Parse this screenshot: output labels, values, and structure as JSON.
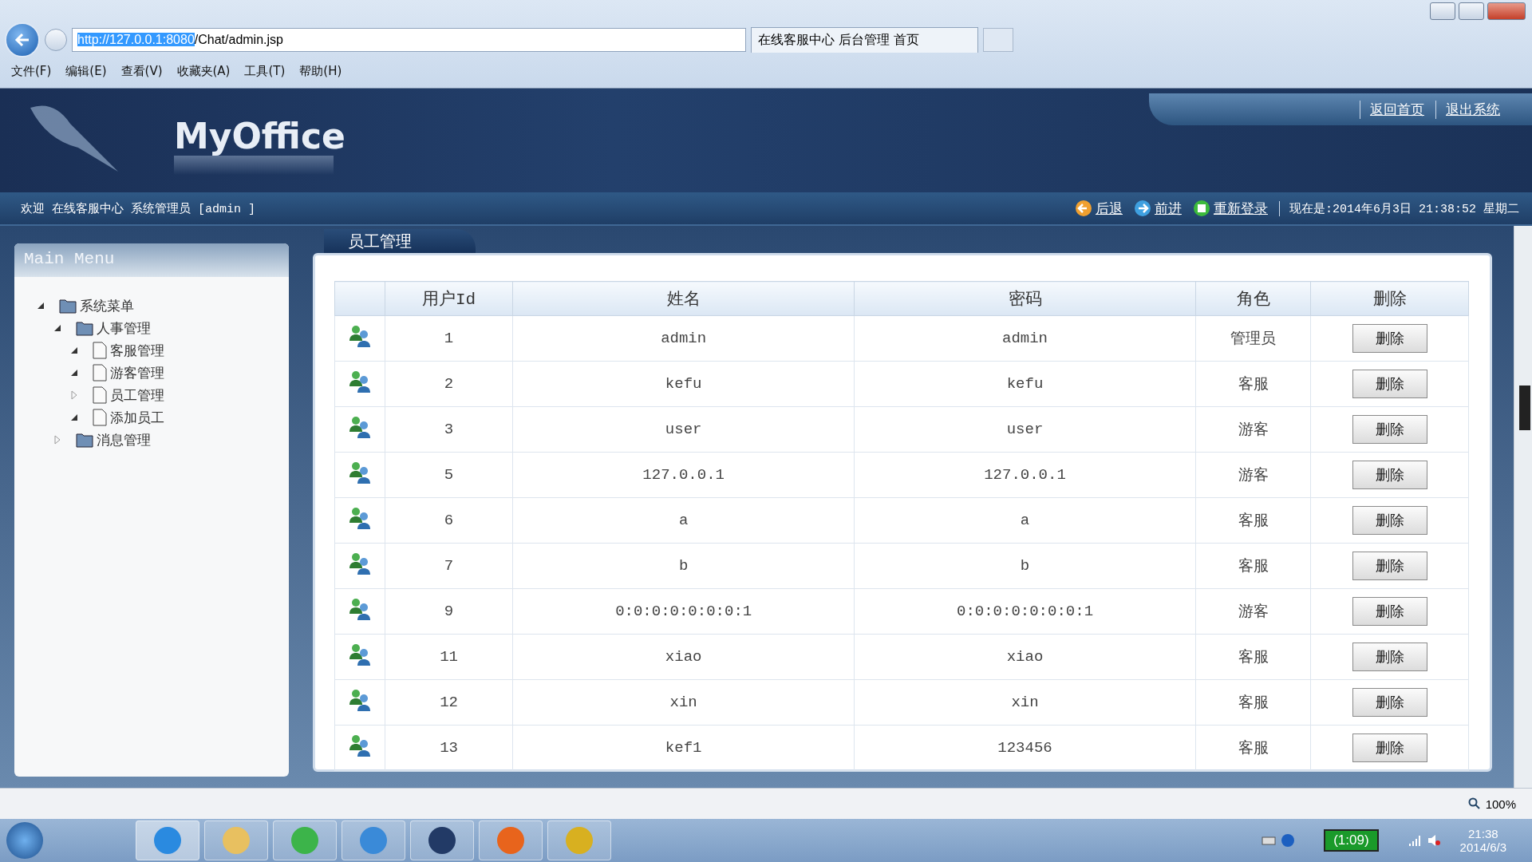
{
  "browser": {
    "address_selected": "http://127.0.0.1:8080",
    "address_rest": "/Chat/admin.jsp",
    "tab_title": "在线客服中心 后台管理 首页",
    "menu": [
      "文件(F)",
      "编辑(E)",
      "查看(V)",
      "收藏夹(A)",
      "工具(T)",
      "帮助(H)"
    ],
    "zoom": "100%"
  },
  "header": {
    "logo": "MyOffice",
    "links": [
      "返回首页",
      "退出系统"
    ]
  },
  "strip": {
    "welcome": "欢迎 在线客服中心 系统管理员 [admin ]",
    "nav": [
      {
        "label": "后退",
        "kind": "back"
      },
      {
        "label": "前进",
        "kind": "forward"
      },
      {
        "label": "重新登录",
        "kind": "relogin"
      }
    ],
    "clock": "现在是:2014年6月3日 21:38:52 星期二"
  },
  "sidebar": {
    "title": "Main Menu",
    "tree": [
      {
        "label": "系统菜单",
        "kind": "folder",
        "expanded": true,
        "children": [
          {
            "label": "人事管理",
            "kind": "folder",
            "expanded": true,
            "children": [
              {
                "label": "客服管理",
                "kind": "page",
                "expanded": true
              },
              {
                "label": "游客管理",
                "kind": "page",
                "expanded": true
              },
              {
                "label": "员工管理",
                "kind": "page",
                "expanded": false
              },
              {
                "label": "添加员工",
                "kind": "page",
                "expanded": true
              }
            ]
          },
          {
            "label": "消息管理",
            "kind": "folder",
            "expanded": false
          }
        ]
      }
    ]
  },
  "panel": {
    "tab": "员工管理",
    "table": {
      "columns": [
        "用户Id",
        "姓名",
        "密码",
        "角色",
        "删除"
      ],
      "rows": [
        {
          "id": "1",
          "name": "admin",
          "password": "admin",
          "role": "管理员",
          "action": "删除"
        },
        {
          "id": "2",
          "name": "kefu",
          "password": "kefu",
          "role": "客服",
          "action": "删除"
        },
        {
          "id": "3",
          "name": "user",
          "password": "user",
          "role": "游客",
          "action": "删除"
        },
        {
          "id": "5",
          "name": "127.0.0.1",
          "password": "127.0.0.1",
          "role": "游客",
          "action": "删除"
        },
        {
          "id": "6",
          "name": "a",
          "password": "a",
          "role": "客服",
          "action": "删除"
        },
        {
          "id": "7",
          "name": "b",
          "password": "b",
          "role": "客服",
          "action": "删除"
        },
        {
          "id": "9",
          "name": "0:0:0:0:0:0:0:1",
          "password": "0:0:0:0:0:0:0:1",
          "role": "游客",
          "action": "删除"
        },
        {
          "id": "11",
          "name": "xiao",
          "password": "xiao",
          "role": "客服",
          "action": "删除"
        },
        {
          "id": "12",
          "name": "xin",
          "password": "xin",
          "role": "客服",
          "action": "删除"
        },
        {
          "id": "13",
          "name": "kef1",
          "password": "123456",
          "role": "客服",
          "action": "删除"
        }
      ]
    }
  },
  "taskbar": {
    "apps": [
      {
        "kind": "ie",
        "selected": true
      },
      {
        "kind": "explorer",
        "selected": false
      },
      {
        "kind": "browser-green",
        "selected": false
      },
      {
        "kind": "cloud",
        "selected": false
      },
      {
        "kind": "script",
        "selected": false
      },
      {
        "kind": "firefox",
        "selected": false
      },
      {
        "kind": "editor",
        "selected": false
      }
    ],
    "battery": "(1:09)",
    "time": "21:38",
    "date": "2014/6/3"
  }
}
